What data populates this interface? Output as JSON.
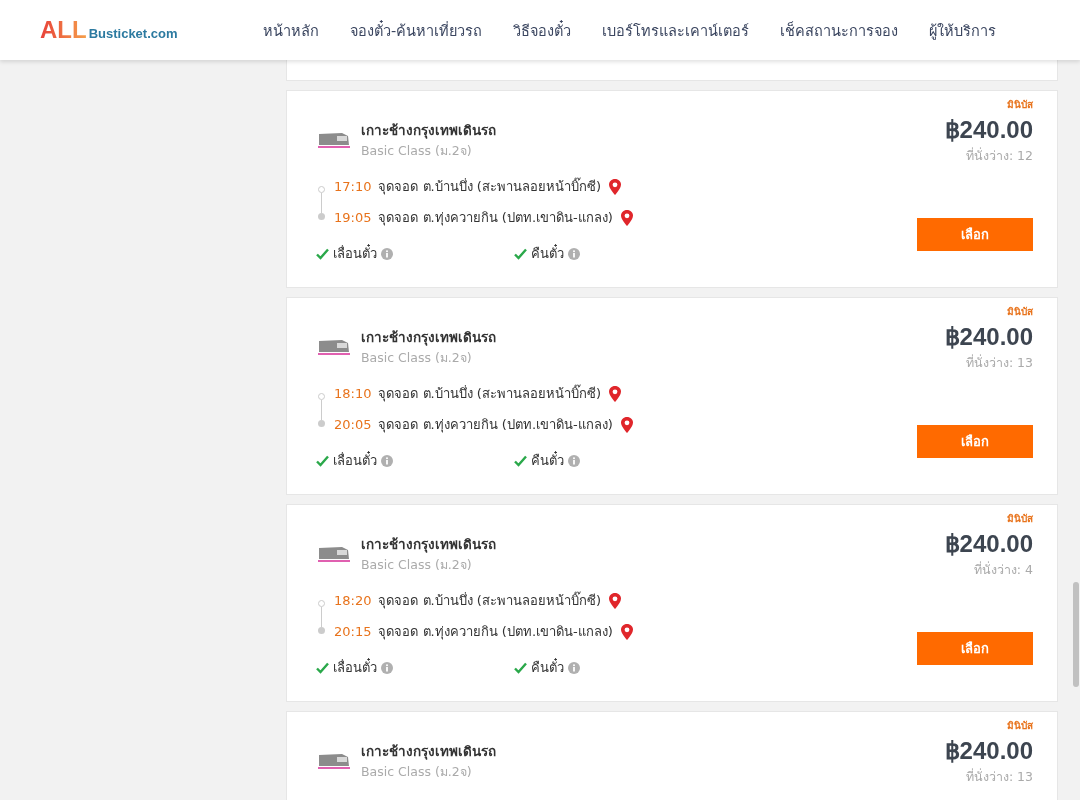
{
  "logo": {
    "brand": "ALL",
    "domain": "Busticket.com"
  },
  "nav": [
    "หน้าหลัก",
    "จองตั๋ว-ค้นหาเที่ยวรถ",
    "วิธีจองตั๋ว",
    "เบอร์โทรและเคาน์เตอร์",
    "เช็คสถานะการจอง",
    "ผู้ให้บริการ"
  ],
  "trips": [
    {
      "operator": "เกาะช้างกรุงเทพเดินรถ",
      "class": "Basic Class (ม.2จ)",
      "badge": "มินิบัส",
      "price": "฿240.00",
      "seats": "ที่นั่งว่าง: 12",
      "stops": [
        {
          "time": "17:10",
          "place": "จุดจอด ต.บ้านบึ่ง (สะพานลอยหน้าบิ๊กซี)"
        },
        {
          "time": "19:05",
          "place": "จุดจอด ต.ทุ่งควายกิน (ปตท.เขาดิน-แกลง)"
        }
      ],
      "features": [
        "เลื่อนตั๋ว",
        "คืนตั๋ว"
      ],
      "button": "เลือก"
    },
    {
      "operator": "เกาะช้างกรุงเทพเดินรถ",
      "class": "Basic Class (ม.2จ)",
      "badge": "มินิบัส",
      "price": "฿240.00",
      "seats": "ที่นั่งว่าง: 13",
      "stops": [
        {
          "time": "18:10",
          "place": "จุดจอด ต.บ้านบึ่ง (สะพานลอยหน้าบิ๊กซี)"
        },
        {
          "time": "20:05",
          "place": "จุดจอด ต.ทุ่งควายกิน (ปตท.เขาดิน-แกลง)"
        }
      ],
      "features": [
        "เลื่อนตั๋ว",
        "คืนตั๋ว"
      ],
      "button": "เลือก"
    },
    {
      "operator": "เกาะช้างกรุงเทพเดินรถ",
      "class": "Basic Class (ม.2จ)",
      "badge": "มินิบัส",
      "price": "฿240.00",
      "seats": "ที่นั่งว่าง: 4",
      "stops": [
        {
          "time": "18:20",
          "place": "จุดจอด ต.บ้านบึ่ง (สะพานลอยหน้าบิ๊กซี)"
        },
        {
          "time": "20:15",
          "place": "จุดจอด ต.ทุ่งควายกิน (ปตท.เขาดิน-แกลง)"
        }
      ],
      "features": [
        "เลื่อนตั๋ว",
        "คืนตั๋ว"
      ],
      "button": "เลือก"
    },
    {
      "operator": "เกาะช้างกรุงเทพเดินรถ",
      "class": "Basic Class (ม.2จ)",
      "badge": "มินิบัส",
      "price": "฿240.00",
      "seats": "ที่นั่งว่าง: 13"
    }
  ]
}
